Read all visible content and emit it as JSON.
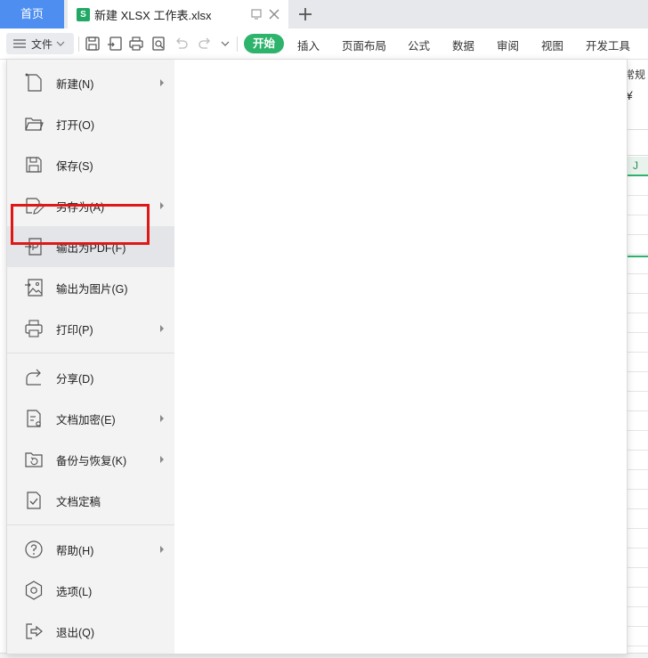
{
  "tabbar": {
    "home_label": "首页",
    "doc_title": "新建 XLSX 工作表.xlsx",
    "doc_icon_letter": "S"
  },
  "toolbar": {
    "file_label": "文件",
    "tabs": [
      {
        "label": "开始",
        "active": true
      },
      {
        "label": "插入"
      },
      {
        "label": "页面布局"
      },
      {
        "label": "公式"
      },
      {
        "label": "数据"
      },
      {
        "label": "审阅"
      },
      {
        "label": "视图"
      },
      {
        "label": "开发工具"
      }
    ]
  },
  "ribbon": {
    "number_format": "常规",
    "currency_symbol": "¥"
  },
  "sheet": {
    "visible_column": "J"
  },
  "file_menu": {
    "items": [
      {
        "label": "新建(N)",
        "icon": "new-file-icon",
        "submenu": true
      },
      {
        "label": "打开(O)",
        "icon": "folder-open-icon",
        "submenu": false
      },
      {
        "label": "保存(S)",
        "icon": "save-icon",
        "submenu": false
      },
      {
        "label": "另存为(A)",
        "icon": "save-as-icon",
        "submenu": true
      },
      {
        "label": "输出为PDF(F)",
        "icon": "export-pdf-icon",
        "submenu": false,
        "highlighted": true
      },
      {
        "label": "输出为图片(G)",
        "icon": "export-image-icon",
        "submenu": false
      },
      {
        "label": "打印(P)",
        "icon": "print-icon",
        "submenu": true
      },
      {
        "label": "分享(D)",
        "icon": "share-icon",
        "submenu": false
      },
      {
        "label": "文档加密(E)",
        "icon": "encrypt-icon",
        "submenu": true
      },
      {
        "label": "备份与恢复(K)",
        "icon": "backup-restore-icon",
        "submenu": true
      },
      {
        "label": "文档定稿",
        "icon": "finalize-icon",
        "submenu": false
      },
      {
        "label": "帮助(H)",
        "icon": "help-icon",
        "submenu": true
      },
      {
        "label": "选项(L)",
        "icon": "options-gear-icon",
        "submenu": false
      },
      {
        "label": "退出(Q)",
        "icon": "exit-icon",
        "submenu": false
      }
    ]
  },
  "colors": {
    "accent_green": "#2db36b",
    "home_tab_blue": "#4d8ef0",
    "highlight_red": "#e01717"
  }
}
